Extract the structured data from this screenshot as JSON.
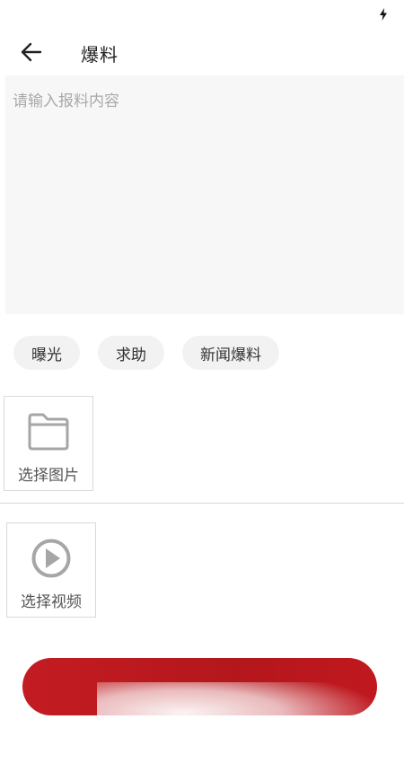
{
  "header": {
    "title": "爆料"
  },
  "report": {
    "placeholder": "请输入报料内容",
    "value": ""
  },
  "tags": [
    {
      "label": "曝光"
    },
    {
      "label": "求助"
    },
    {
      "label": "新闻爆料"
    }
  ],
  "media": {
    "image_label": "选择图片",
    "video_label": "选择视频"
  },
  "submit": {
    "label": ""
  },
  "colors": {
    "accent": "#b9181e",
    "input_bg": "#f7f7f7",
    "tag_bg": "#f2f2f2",
    "icon_gray": "#a6a6a6"
  },
  "icons": {
    "status": "charging-bolt-icon",
    "back": "arrow-left-icon",
    "image": "folder-icon",
    "video": "play-circle-icon"
  }
}
